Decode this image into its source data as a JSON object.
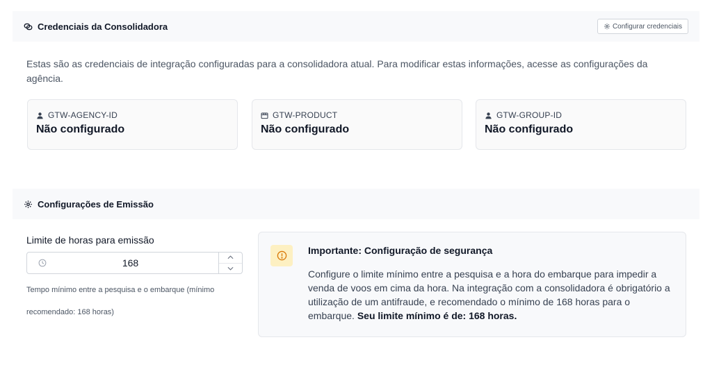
{
  "credentials": {
    "title": "Credenciais da Consolidadora",
    "configure_button": "Configurar credenciais",
    "description": "Estas são as credenciais de integração configuradas para a consolidadora atual. Para modificar estas informações, acesse as configurações da agência.",
    "cards": [
      {
        "label": "GTW-AGENCY-ID",
        "value": "Não configurado",
        "icon": "user-icon"
      },
      {
        "label": "GTW-PRODUCT",
        "value": "Não configurado",
        "icon": "package-icon"
      },
      {
        "label": "GTW-GROUP-ID",
        "value": "Não configurado",
        "icon": "user-icon"
      }
    ]
  },
  "emission": {
    "title": "Configurações de Emissão",
    "limit_label": "Limite de horas para emissão",
    "limit_value": "168",
    "limit_help": "Tempo mínimo entre a pesquisa e o embarque (mínimo recomendado: 168 horas)",
    "alert": {
      "title": "Importante: Configuração de segurança",
      "body": "Configure o limite mínimo entre a pesquisa e a hora do embarque para impedir a venda de voos em cima da hora. Na integração com a consolidadora é obrigatório a utilização de um antifraude, e recomendado o mínimo de 168 horas para o embarque.",
      "emphasis": "Seu limite mínimo é de: 168 horas.",
      "icon": "alert-circle-icon"
    }
  },
  "colors": {
    "header_bg": "#f8f9fb",
    "alert_icon_bg": "#fdf0c2",
    "alert_icon": "#d97706"
  }
}
